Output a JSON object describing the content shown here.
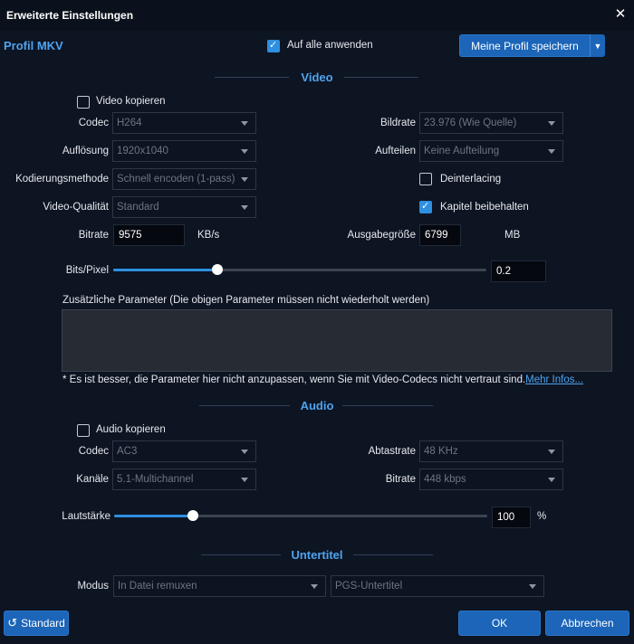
{
  "window": {
    "title": "Erweiterte Einstellungen",
    "close": "✕"
  },
  "profile": {
    "name": "Profil MKV",
    "apply_all_label": "Auf alle anwenden",
    "apply_all_checked": true,
    "save_label": "Meine Profil speichern",
    "save_dropdown_icon": "chevron-down-icon"
  },
  "video": {
    "section_title": "Video",
    "copy_label": "Video kopieren",
    "copy_checked": false,
    "codec": {
      "label": "Codec",
      "value": "H264"
    },
    "resolution": {
      "label": "Auflösung",
      "value": "1920x1040"
    },
    "encoding": {
      "label": "Kodierungsmethode",
      "value": "Schnell encoden (1-pass)"
    },
    "quality": {
      "label": "Video-Qualität",
      "value": "Standard"
    },
    "bitrate": {
      "label": "Bitrate",
      "value": "9575",
      "unit": "KB/s"
    },
    "framerate": {
      "label": "Bildrate",
      "value": "23.976 (Wie Quelle)"
    },
    "split": {
      "label": "Aufteilen",
      "value": "Keine Aufteilung"
    },
    "deinterlace": {
      "label": "Deinterlacing",
      "checked": false
    },
    "chapters": {
      "label": "Kapitel beibehalten",
      "checked": true
    },
    "output_size": {
      "label": "Ausgabegröße",
      "value": "6799",
      "unit": "MB"
    },
    "bits_per_pixel": {
      "label": "Bits/Pixel",
      "value": "0.2",
      "fraction": 0.28
    },
    "extra_params_label": "Zusätzliche Parameter (Die obigen Parameter müssen nicht wiederholt werden)",
    "extra_params_value": "",
    "note": "* Es ist besser, die Parameter hier nicht anzupassen, wenn Sie mit Video-Codecs nicht vertraut sind.",
    "more_info": "Mehr Infos..."
  },
  "audio": {
    "section_title": "Audio",
    "copy_label": "Audio kopieren",
    "copy_checked": false,
    "codec": {
      "label": "Codec",
      "value": "AC3"
    },
    "channels": {
      "label": "Kanäle",
      "value": "5.1-Multichannel"
    },
    "samplerate": {
      "label": "Abtastrate",
      "value": "48 KHz"
    },
    "bitrate": {
      "label": "Bitrate",
      "value": "448 kbps"
    },
    "volume": {
      "label": "Lautstärke",
      "value": "100",
      "unit": "%",
      "fraction": 0.21
    }
  },
  "subtitle": {
    "section_title": "Untertitel",
    "mode": {
      "label": "Modus",
      "value": "In Datei remuxen"
    },
    "format": {
      "value": "PGS-Untertitel"
    }
  },
  "footer": {
    "reset_label": "Standard",
    "reset_icon": "reset-icon",
    "ok_label": "OK",
    "cancel_label": "Abbrechen"
  },
  "colors": {
    "accent": "#4ea4f0",
    "button": "#1c65b8",
    "background": "#0d1422"
  }
}
